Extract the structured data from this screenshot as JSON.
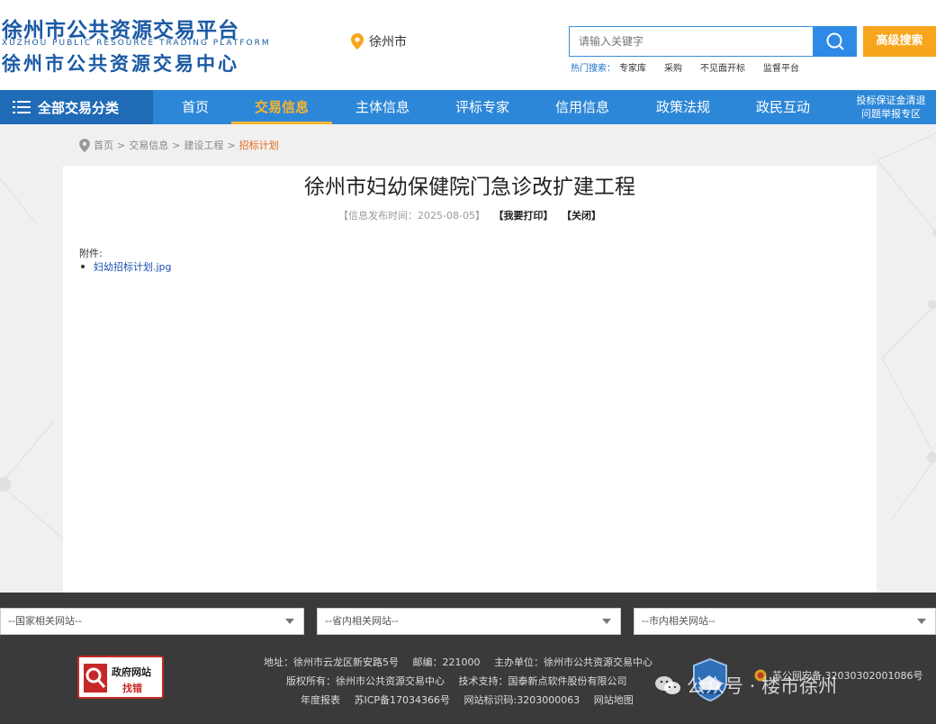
{
  "header": {
    "logo_cn1": "徐州市公共资源交易平台",
    "logo_en": "XUZHOU PUBLIC RESOURCE TRADING PLATFORM",
    "logo_cn2": "徐州市公共资源交易中心",
    "location": "徐州市",
    "search_placeholder": "请输入关键字",
    "advanced_search": "高级搜索",
    "hot_label": "热门搜索：",
    "hot_items": [
      "专家库",
      "采购",
      "不见面开标",
      "监督平台"
    ]
  },
  "nav": {
    "all_categories": "全部交易分类",
    "items": [
      "首页",
      "交易信息",
      "主体信息",
      "评标专家",
      "信用信息",
      "政策法规",
      "政民互动"
    ],
    "active_index": 1,
    "right_line1": "投标保证金清退",
    "right_line2": "问题举报专区"
  },
  "breadcrumb": [
    "首页",
    "交易信息",
    "建设工程",
    "招标计划"
  ],
  "article": {
    "title": "徐州市妇幼保健院门急诊改扩建工程",
    "publish_label": "【信息发布时间：2025-08-05】",
    "print": "【我要打印】",
    "close": "【关闭】",
    "attachment_label": "附件:",
    "attachments": [
      "妇幼招标计划.jpg"
    ]
  },
  "selects": [
    "--国家相关网站--",
    "--省内相关网站--",
    "--市内相关网站--"
  ],
  "footer": {
    "gov_badge_line1": "政府网站",
    "gov_badge_line2": "找错",
    "address": "地址：徐州市云龙区新安路5号",
    "postcode": "邮编：221000",
    "host": "主办单位：徐州市公共资源交易中心",
    "copyright": "版权所有：徐州市公共资源交易中心",
    "tech": "技术支持：国泰新点软件股份有限公司",
    "annual_report": "年度报表",
    "icp": "苏ICP备17034366号",
    "site_code": "网站标识码:3203000063",
    "sitemap": "网站地图",
    "police_beian": "苏公网安备 32030302001086号",
    "watermark": "公众号 · 楼市徐州"
  },
  "colors": {
    "brand_blue": "#1b5aa5",
    "nav_blue": "#2d87d8",
    "accent_orange": "#f7a51c",
    "footer_dark": "#3a3a3a"
  }
}
